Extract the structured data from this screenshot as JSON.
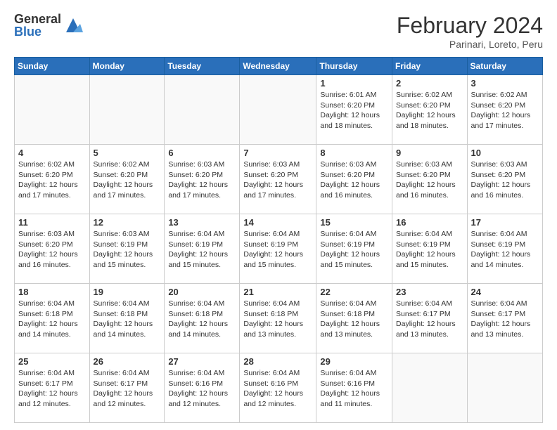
{
  "logo": {
    "general": "General",
    "blue": "Blue"
  },
  "title": "February 2024",
  "subtitle": "Parinari, Loreto, Peru",
  "weekdays": [
    "Sunday",
    "Monday",
    "Tuesday",
    "Wednesday",
    "Thursday",
    "Friday",
    "Saturday"
  ],
  "weeks": [
    [
      {
        "day": "",
        "info": ""
      },
      {
        "day": "",
        "info": ""
      },
      {
        "day": "",
        "info": ""
      },
      {
        "day": "",
        "info": ""
      },
      {
        "day": "1",
        "info": "Sunrise: 6:01 AM\nSunset: 6:20 PM\nDaylight: 12 hours and 18 minutes."
      },
      {
        "day": "2",
        "info": "Sunrise: 6:02 AM\nSunset: 6:20 PM\nDaylight: 12 hours and 18 minutes."
      },
      {
        "day": "3",
        "info": "Sunrise: 6:02 AM\nSunset: 6:20 PM\nDaylight: 12 hours and 17 minutes."
      }
    ],
    [
      {
        "day": "4",
        "info": "Sunrise: 6:02 AM\nSunset: 6:20 PM\nDaylight: 12 hours and 17 minutes."
      },
      {
        "day": "5",
        "info": "Sunrise: 6:02 AM\nSunset: 6:20 PM\nDaylight: 12 hours and 17 minutes."
      },
      {
        "day": "6",
        "info": "Sunrise: 6:03 AM\nSunset: 6:20 PM\nDaylight: 12 hours and 17 minutes."
      },
      {
        "day": "7",
        "info": "Sunrise: 6:03 AM\nSunset: 6:20 PM\nDaylight: 12 hours and 17 minutes."
      },
      {
        "day": "8",
        "info": "Sunrise: 6:03 AM\nSunset: 6:20 PM\nDaylight: 12 hours and 16 minutes."
      },
      {
        "day": "9",
        "info": "Sunrise: 6:03 AM\nSunset: 6:20 PM\nDaylight: 12 hours and 16 minutes."
      },
      {
        "day": "10",
        "info": "Sunrise: 6:03 AM\nSunset: 6:20 PM\nDaylight: 12 hours and 16 minutes."
      }
    ],
    [
      {
        "day": "11",
        "info": "Sunrise: 6:03 AM\nSunset: 6:20 PM\nDaylight: 12 hours and 16 minutes."
      },
      {
        "day": "12",
        "info": "Sunrise: 6:03 AM\nSunset: 6:19 PM\nDaylight: 12 hours and 15 minutes."
      },
      {
        "day": "13",
        "info": "Sunrise: 6:04 AM\nSunset: 6:19 PM\nDaylight: 12 hours and 15 minutes."
      },
      {
        "day": "14",
        "info": "Sunrise: 6:04 AM\nSunset: 6:19 PM\nDaylight: 12 hours and 15 minutes."
      },
      {
        "day": "15",
        "info": "Sunrise: 6:04 AM\nSunset: 6:19 PM\nDaylight: 12 hours and 15 minutes."
      },
      {
        "day": "16",
        "info": "Sunrise: 6:04 AM\nSunset: 6:19 PM\nDaylight: 12 hours and 15 minutes."
      },
      {
        "day": "17",
        "info": "Sunrise: 6:04 AM\nSunset: 6:19 PM\nDaylight: 12 hours and 14 minutes."
      }
    ],
    [
      {
        "day": "18",
        "info": "Sunrise: 6:04 AM\nSunset: 6:18 PM\nDaylight: 12 hours and 14 minutes."
      },
      {
        "day": "19",
        "info": "Sunrise: 6:04 AM\nSunset: 6:18 PM\nDaylight: 12 hours and 14 minutes."
      },
      {
        "day": "20",
        "info": "Sunrise: 6:04 AM\nSunset: 6:18 PM\nDaylight: 12 hours and 14 minutes."
      },
      {
        "day": "21",
        "info": "Sunrise: 6:04 AM\nSunset: 6:18 PM\nDaylight: 12 hours and 13 minutes."
      },
      {
        "day": "22",
        "info": "Sunrise: 6:04 AM\nSunset: 6:18 PM\nDaylight: 12 hours and 13 minutes."
      },
      {
        "day": "23",
        "info": "Sunrise: 6:04 AM\nSunset: 6:17 PM\nDaylight: 12 hours and 13 minutes."
      },
      {
        "day": "24",
        "info": "Sunrise: 6:04 AM\nSunset: 6:17 PM\nDaylight: 12 hours and 13 minutes."
      }
    ],
    [
      {
        "day": "25",
        "info": "Sunrise: 6:04 AM\nSunset: 6:17 PM\nDaylight: 12 hours and 12 minutes."
      },
      {
        "day": "26",
        "info": "Sunrise: 6:04 AM\nSunset: 6:17 PM\nDaylight: 12 hours and 12 minutes."
      },
      {
        "day": "27",
        "info": "Sunrise: 6:04 AM\nSunset: 6:16 PM\nDaylight: 12 hours and 12 minutes."
      },
      {
        "day": "28",
        "info": "Sunrise: 6:04 AM\nSunset: 6:16 PM\nDaylight: 12 hours and 12 minutes."
      },
      {
        "day": "29",
        "info": "Sunrise: 6:04 AM\nSunset: 6:16 PM\nDaylight: 12 hours and 11 minutes."
      },
      {
        "day": "",
        "info": ""
      },
      {
        "day": "",
        "info": ""
      }
    ]
  ]
}
